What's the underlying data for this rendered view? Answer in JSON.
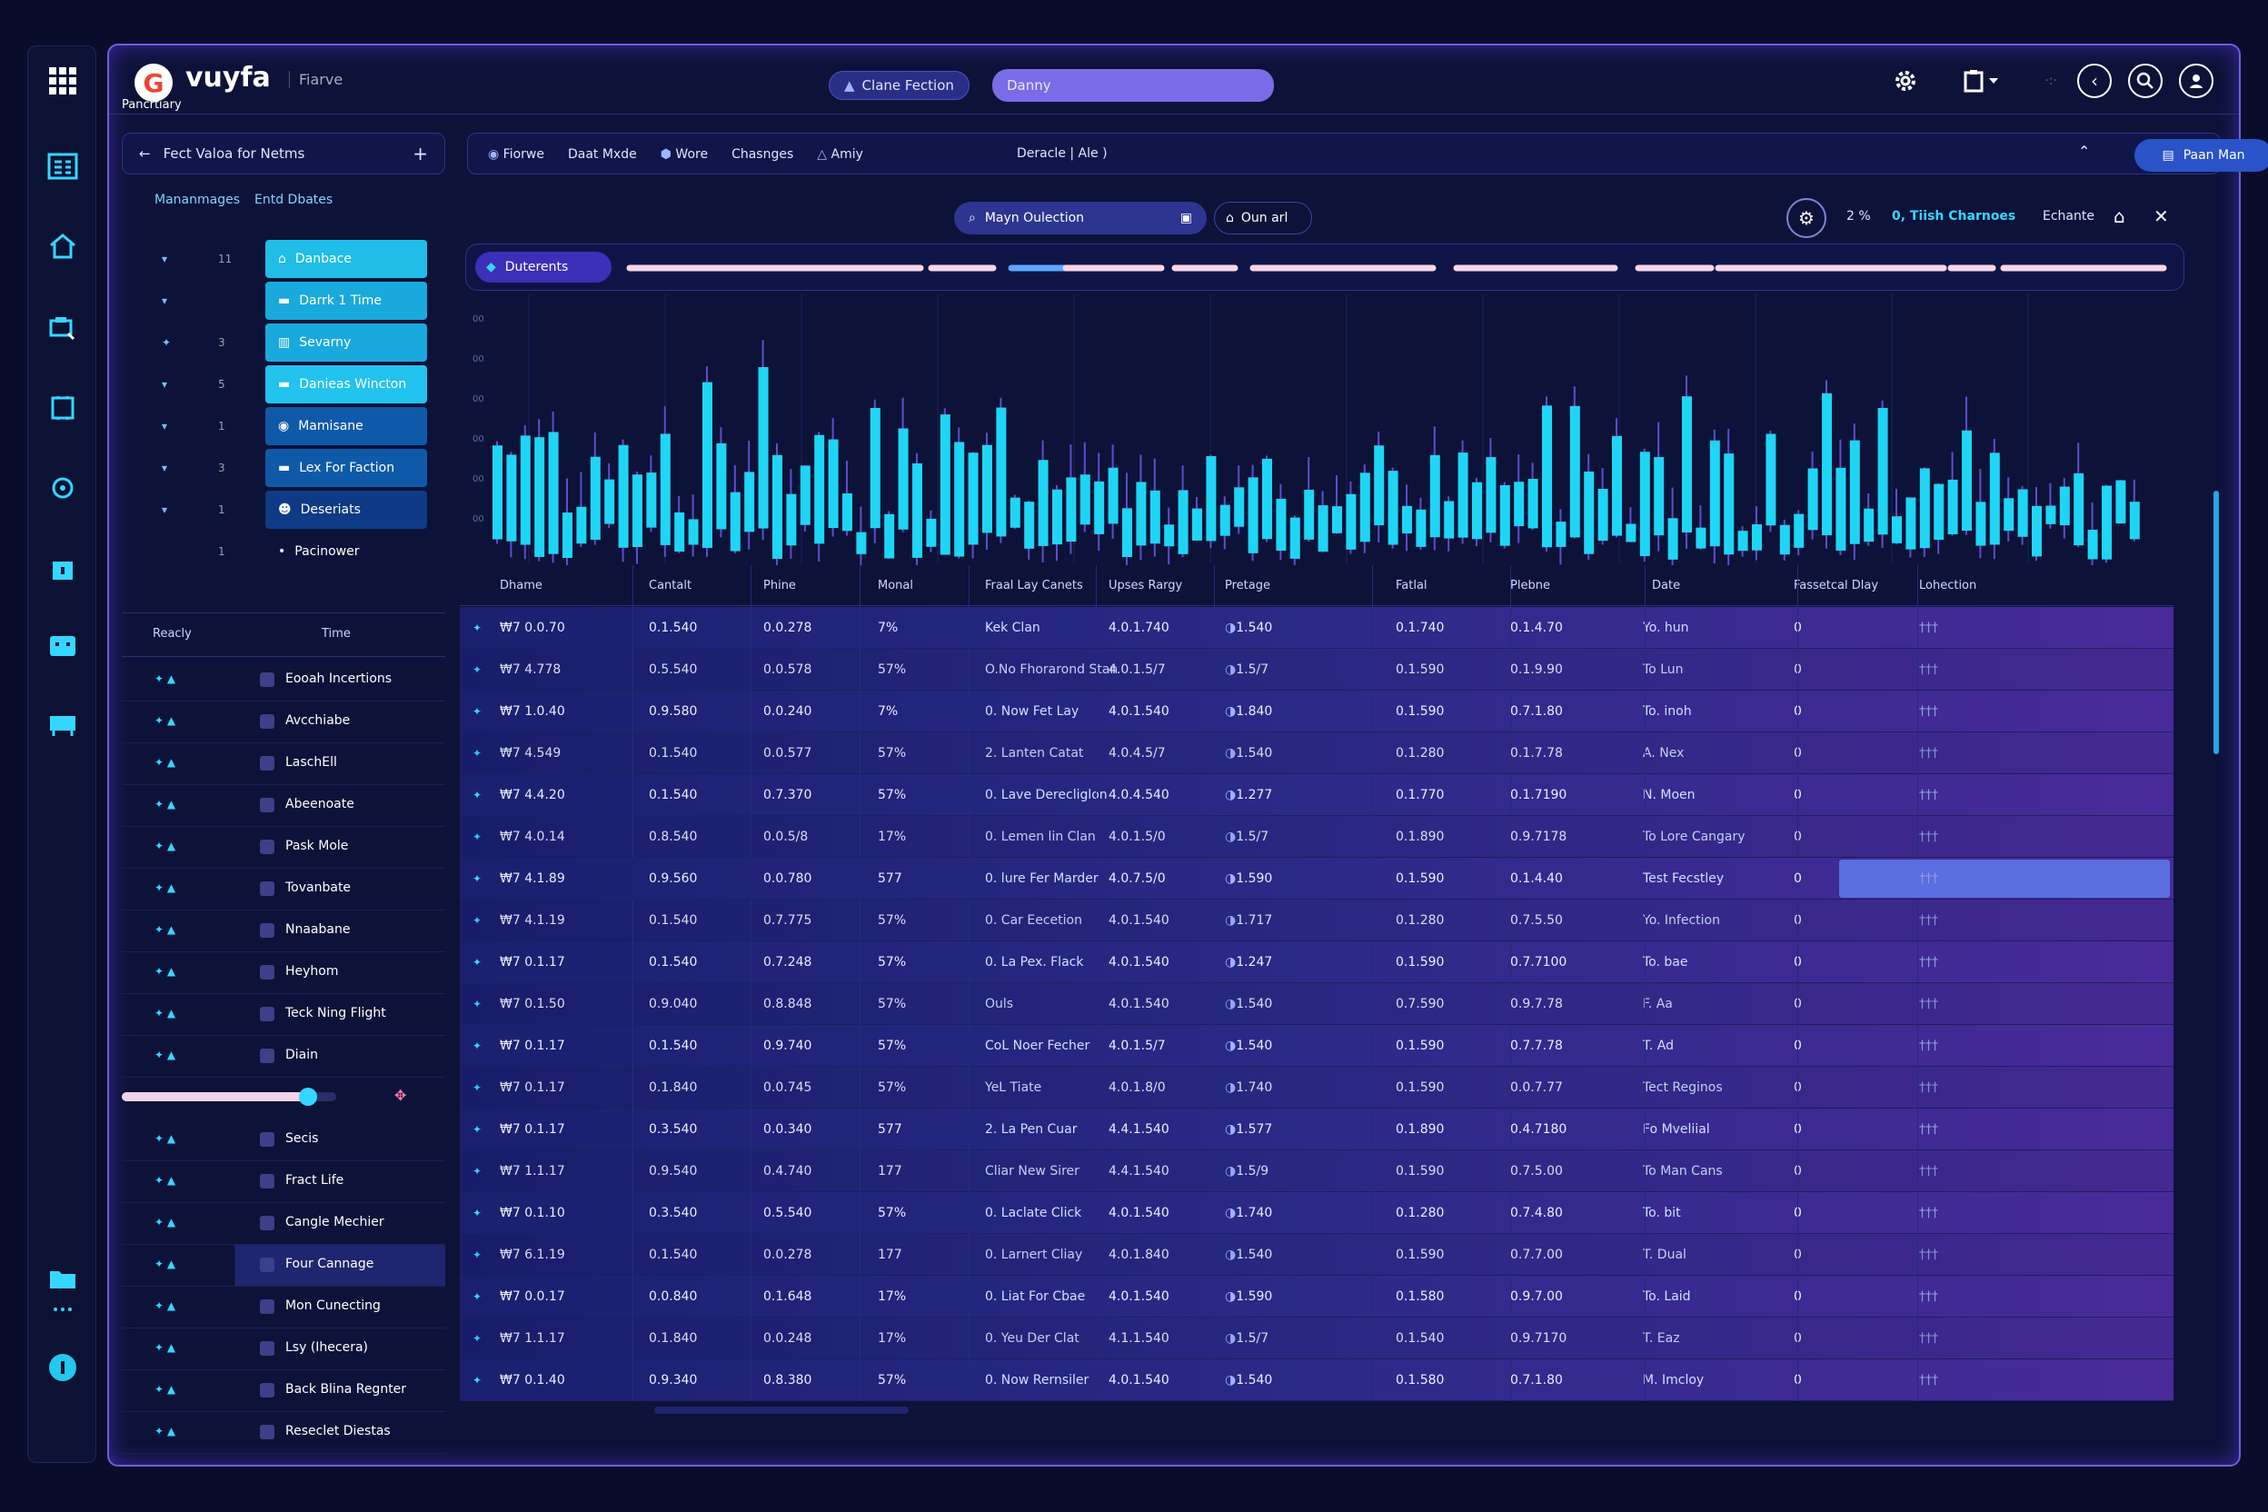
{
  "app": {
    "title": "vuyfa",
    "subtitle": "Fiarve",
    "logo_letter": "G"
  },
  "topbar": {
    "center_pill": "Clane Fection",
    "search_value": "Danny"
  },
  "left_panel": {
    "title": "Fect Valoa for Netms",
    "tab1": "Mananmages",
    "tab2": "Entd Dbates",
    "tree": [
      {
        "ctl": "▾",
        "num": "11",
        "label": "Danbace",
        "icon": "home-icon"
      },
      {
        "ctl": "▾",
        "num": "",
        "label": "Darrk 1 Time",
        "icon": "folder-icon"
      },
      {
        "ctl": "✦",
        "num": "3",
        "label": "Sevarny",
        "icon": "bars-icon"
      },
      {
        "ctl": "▾",
        "num": "5",
        "label": "Danieas Wincton",
        "icon": "folder-icon"
      },
      {
        "ctl": "▾",
        "num": "1",
        "label": "Mamisane",
        "icon": "eye-icon"
      },
      {
        "ctl": "▾",
        "num": "3",
        "label": "Lex For Faction",
        "icon": "folder-icon"
      },
      {
        "ctl": "▾",
        "num": "1",
        "label": "Deseriats",
        "icon": "people-icon"
      },
      {
        "ctl": "",
        "num": "1",
        "label": "Pacinower",
        "icon": "dot-icon"
      }
    ],
    "col_ready": "Reacly",
    "col_time": "Time",
    "rows": [
      "Eooah Incertions",
      "Avcchiabe",
      "LaschEll",
      "Abeenoate",
      "Pask Mole",
      "Tovanbate",
      "Nnaabane",
      "Heyhom",
      "Teck Ning Flight",
      "Diain",
      "",
      "Secis",
      "Fract Life",
      "Cangle Mechier",
      "Four Cannage",
      "Mon Cunecting",
      "Lsy (Ihecera)",
      "Back Blina Regnter",
      "Reseclet Diestas"
    ],
    "section_label": "Pancrtiary",
    "slider_value": 0.87
  },
  "toolbar": {
    "items": [
      "Fiorwe",
      "Daat Mxde",
      "Wore",
      "Chasnges",
      "Amiy"
    ],
    "filter": "Deracle | Ale )",
    "action": "Paan Man"
  },
  "subbar": {
    "search": "Mayn Oulection",
    "home_label": "Oun arl",
    "pct": "2 %",
    "link": "0, Tiish Charnoes",
    "right_label": "Echante"
  },
  "chart": {
    "tab": "Duterents",
    "y_ticks": [
      "00",
      "00",
      "00",
      "00",
      "00",
      "00"
    ]
  },
  "table": {
    "columns": [
      "Dhame",
      "Cantalt",
      "Phine",
      "Monal",
      "Fraal Lay Canets",
      "Upses Rargy",
      "Pretage",
      "Fatlal",
      "Plebne",
      "Date",
      "Fassetcal Dlay",
      "Lohection"
    ],
    "rows": [
      [
        "₩7 0.0.70",
        "0.1.540",
        "0.0.278",
        "7%",
        "Kek Clan",
        "4.0.1.740",
        "1.540",
        "0.1.740",
        "0.1.4.70",
        "Yo. hun",
        "0",
        "†††"
      ],
      [
        "₩7 4.778",
        "0.5.540",
        "0.0.578",
        "57%",
        "O.No Fhorarond Stan",
        "4.0.1.5/7",
        "1.5/7",
        "0.1.590",
        "0.1.9.90",
        "To Lun",
        "0",
        "†††"
      ],
      [
        "₩7 1.0.40",
        "0.9.580",
        "0.0.240",
        "7%",
        "0. Now Fet Lay",
        "4.0.1.540",
        "1.840",
        "0.1.590",
        "0.7.1.80",
        "To. inoh",
        "0",
        "†††"
      ],
      [
        "₩7 4.549",
        "0.1.540",
        "0.0.577",
        "57%",
        "2. Lanten Catat",
        "4.0.4.5/7",
        "1.540",
        "0.1.280",
        "0.1.7.78",
        "A. Nex",
        "0",
        "†††"
      ],
      [
        "₩7 4.4.20",
        "0.1.540",
        "0.7.370",
        "57%",
        "0. Lave Derecliglon",
        "4.0.4.540",
        "1.277",
        "0.1.770",
        "0.1.7190",
        "N. Moen",
        "0",
        "†††"
      ],
      [
        "₩7 4.0.14",
        "0.8.540",
        "0.0.5/8",
        "17%",
        "0. Lemen lin Clan",
        "4.0.1.5/0",
        "1.5/7",
        "0.1.890",
        "0.9.7178",
        "To Lore Cangary",
        "0",
        "†††"
      ],
      [
        "₩7 4.1.89",
        "0.9.560",
        "0.0.780",
        "577",
        "0. lure Fer Marder",
        "4.0.7.5/0",
        "1.590",
        "0.1.590",
        "0.1.4.40",
        "Test Fecstley",
        "0",
        "†††"
      ],
      [
        "₩7 4.1.19",
        "0.1.540",
        "0.7.775",
        "57%",
        "0. Car Eecetion",
        "4.0.1.540",
        "1.717",
        "0.1.280",
        "0.7.5.50",
        "Yo. Infection",
        "0",
        "†††"
      ],
      [
        "₩7 0.1.17",
        "0.1.540",
        "0.7.248",
        "57%",
        "0. La Pex. Flack",
        "4.0.1.540",
        "1.247",
        "0.1.590",
        "0.7.7100",
        "To. bae",
        "0",
        "†††"
      ],
      [
        "₩7 0.1.50",
        "0.9.040",
        "0.8.848",
        "57%",
        "Ouls",
        "4.0.1.540",
        "1.540",
        "0.7.590",
        "0.9.7.78",
        "F. Aa",
        "0",
        "†††"
      ],
      [
        "₩7 0.1.17",
        "0.1.540",
        "0.9.740",
        "57%",
        "CoL Noer Fecher",
        "4.0.1.5/7",
        "1.540",
        "0.1.590",
        "0.7.7.78",
        "T. Ad",
        "0",
        "†††"
      ],
      [
        "₩7 0.1.17",
        "0.1.840",
        "0.0.745",
        "57%",
        "YeL Tiate",
        "4.0.1.8/0",
        "1.740",
        "0.1.590",
        "0.0.7.77",
        "Tect Reginos",
        "0",
        "†††"
      ],
      [
        "₩7 0.1.17",
        "0.3.540",
        "0.0.340",
        "577",
        "2. La Pen Cuar",
        "4.4.1.540",
        "1.577",
        "0.1.890",
        "0.4.7180",
        "Fo Mveliial",
        "0",
        "†††"
      ],
      [
        "₩7 1.1.17",
        "0.9.540",
        "0.4.740",
        "177",
        "Cliar New Sirer",
        "4.4.1.540",
        "1.5/9",
        "0.1.590",
        "0.7.5.00",
        "To Man Cans",
        "0",
        "†††"
      ],
      [
        "₩7 0.1.10",
        "0.3.540",
        "0.5.540",
        "57%",
        "0. Laclate Click",
        "4.0.1.540",
        "1.740",
        "0.1.280",
        "0.7.4.80",
        "To. bit",
        "0",
        "†††"
      ],
      [
        "₩7 6.1.19",
        "0.1.540",
        "0.0.278",
        "177",
        "0. Larnert Cliay",
        "4.0.1.840",
        "1.540",
        "0.1.590",
        "0.7.7.00",
        "T. Dual",
        "0",
        "†††"
      ],
      [
        "₩7 0.0.17",
        "0.0.840",
        "0.1.648",
        "17%",
        "0. Liat For Cbae",
        "4.0.1.540",
        "1.590",
        "0.1.580",
        "0.9.7.00",
        "To. Laid",
        "0",
        "†††"
      ],
      [
        "₩7 1.1.17",
        "0.1.840",
        "0.0.248",
        "17%",
        "0. Yeu Der Clat",
        "4.1.1.540",
        "1.5/7",
        "0.1.540",
        "0.9.7170",
        "T. Eaz",
        "0",
        "†††"
      ],
      [
        "₩7 0.1.40",
        "0.9.340",
        "0.8.380",
        "57%",
        "0. Now Rernsiler",
        "4.0.1.540",
        "1.540",
        "0.1.580",
        "0.7.1.80",
        "M. Imcloy",
        "0",
        "†††"
      ]
    ]
  },
  "colors": {
    "accent": "#23c8ef",
    "purple": "#6c5ce7",
    "bg": "#0d1238"
  }
}
